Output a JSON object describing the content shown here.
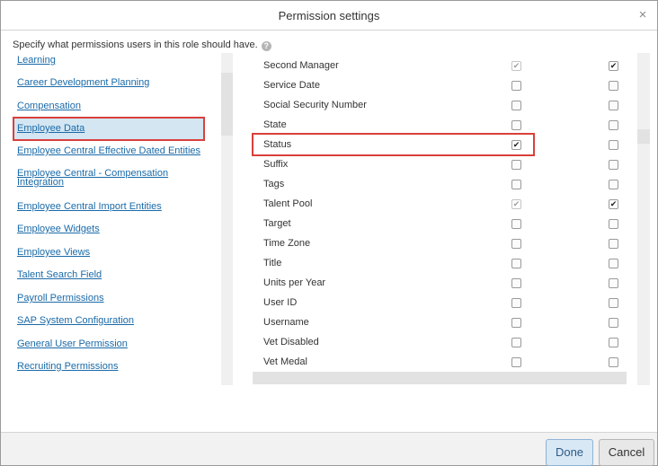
{
  "dialog": {
    "title": "Permission settings",
    "close_glyph": "×",
    "intro": "Specify what permissions users in this role should have.",
    "help_glyph": "?"
  },
  "categories": [
    {
      "label": "Learning"
    },
    {
      "label": "Career Development Planning"
    },
    {
      "label": "Compensation"
    },
    {
      "label": "Employee Data",
      "selected": true
    },
    {
      "label": "Employee Central Effective Dated Entities"
    },
    {
      "label": "Employee Central - Compensation Integration"
    },
    {
      "label": "Employee Central Import Entities"
    },
    {
      "label": "Employee Widgets"
    },
    {
      "label": "Employee Views"
    },
    {
      "label": "Talent Search Field"
    },
    {
      "label": "Payroll Permissions"
    },
    {
      "label": "SAP System Configuration"
    },
    {
      "label": "General User Permission"
    },
    {
      "label": "Recruiting Permissions"
    }
  ],
  "fields": [
    {
      "label": "Second Manager",
      "col1": "checked-disabled",
      "col2": "checked"
    },
    {
      "label": "Service Date",
      "col1": "unchecked",
      "col2": "unchecked"
    },
    {
      "label": "Social Security Number",
      "col1": "unchecked",
      "col2": "unchecked"
    },
    {
      "label": "State",
      "col1": "unchecked",
      "col2": "unchecked"
    },
    {
      "label": "Status",
      "col1": "checked",
      "col2": "unchecked",
      "highlighted": true
    },
    {
      "label": "Suffix",
      "col1": "unchecked",
      "col2": "unchecked"
    },
    {
      "label": "Tags",
      "col1": "unchecked",
      "col2": "unchecked"
    },
    {
      "label": "Talent Pool",
      "col1": "checked-disabled",
      "col2": "checked"
    },
    {
      "label": "Target",
      "col1": "unchecked",
      "col2": "unchecked"
    },
    {
      "label": "Time Zone",
      "col1": "unchecked",
      "col2": "unchecked"
    },
    {
      "label": "Title",
      "col1": "unchecked",
      "col2": "unchecked"
    },
    {
      "label": "Units per Year",
      "col1": "unchecked",
      "col2": "unchecked"
    },
    {
      "label": "User ID",
      "col1": "unchecked",
      "col2": "unchecked"
    },
    {
      "label": "Username",
      "col1": "unchecked",
      "col2": "unchecked"
    },
    {
      "label": "Vet Disabled",
      "col1": "unchecked",
      "col2": "unchecked"
    },
    {
      "label": "Vet Medal",
      "col1": "unchecked",
      "col2": "unchecked"
    }
  ],
  "footer": {
    "done_label": "Done",
    "cancel_label": "Cancel"
  },
  "colors": {
    "link": "#1a6aa8",
    "highlight_border": "#d9403c",
    "selected_bg": "#d3e6f2"
  }
}
